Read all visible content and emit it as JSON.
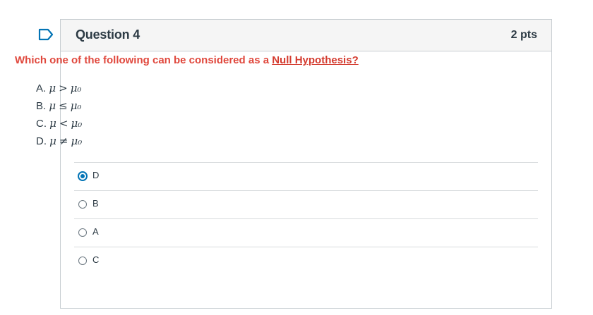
{
  "question": {
    "title": "Question 4",
    "points": "2 pts",
    "prompt_prefix": "Which one of the following can be considered as a ",
    "prompt_link": "Null Hypothesis?",
    "statements": [
      {
        "letter": "A.",
        "lhs": "μ",
        "op": ">",
        "rhs": "μ₀"
      },
      {
        "letter": "B.",
        "lhs": "μ",
        "op": "≤",
        "rhs": "μ₀"
      },
      {
        "letter": "C.",
        "lhs": "μ",
        "op": "<",
        "rhs": "μ₀"
      },
      {
        "letter": "D.",
        "lhs": "μ",
        "op": "≠",
        "rhs": "μ₀"
      }
    ]
  },
  "answers": [
    {
      "label": "D",
      "selected": true
    },
    {
      "label": "B",
      "selected": false
    },
    {
      "label": "A",
      "selected": false
    },
    {
      "label": "C",
      "selected": false
    }
  ],
  "colors": {
    "accent": "#0374b5",
    "prompt": "#e0483d",
    "text": "#2d3b45"
  },
  "icons": {
    "flag": "bookmark-flag-icon"
  }
}
